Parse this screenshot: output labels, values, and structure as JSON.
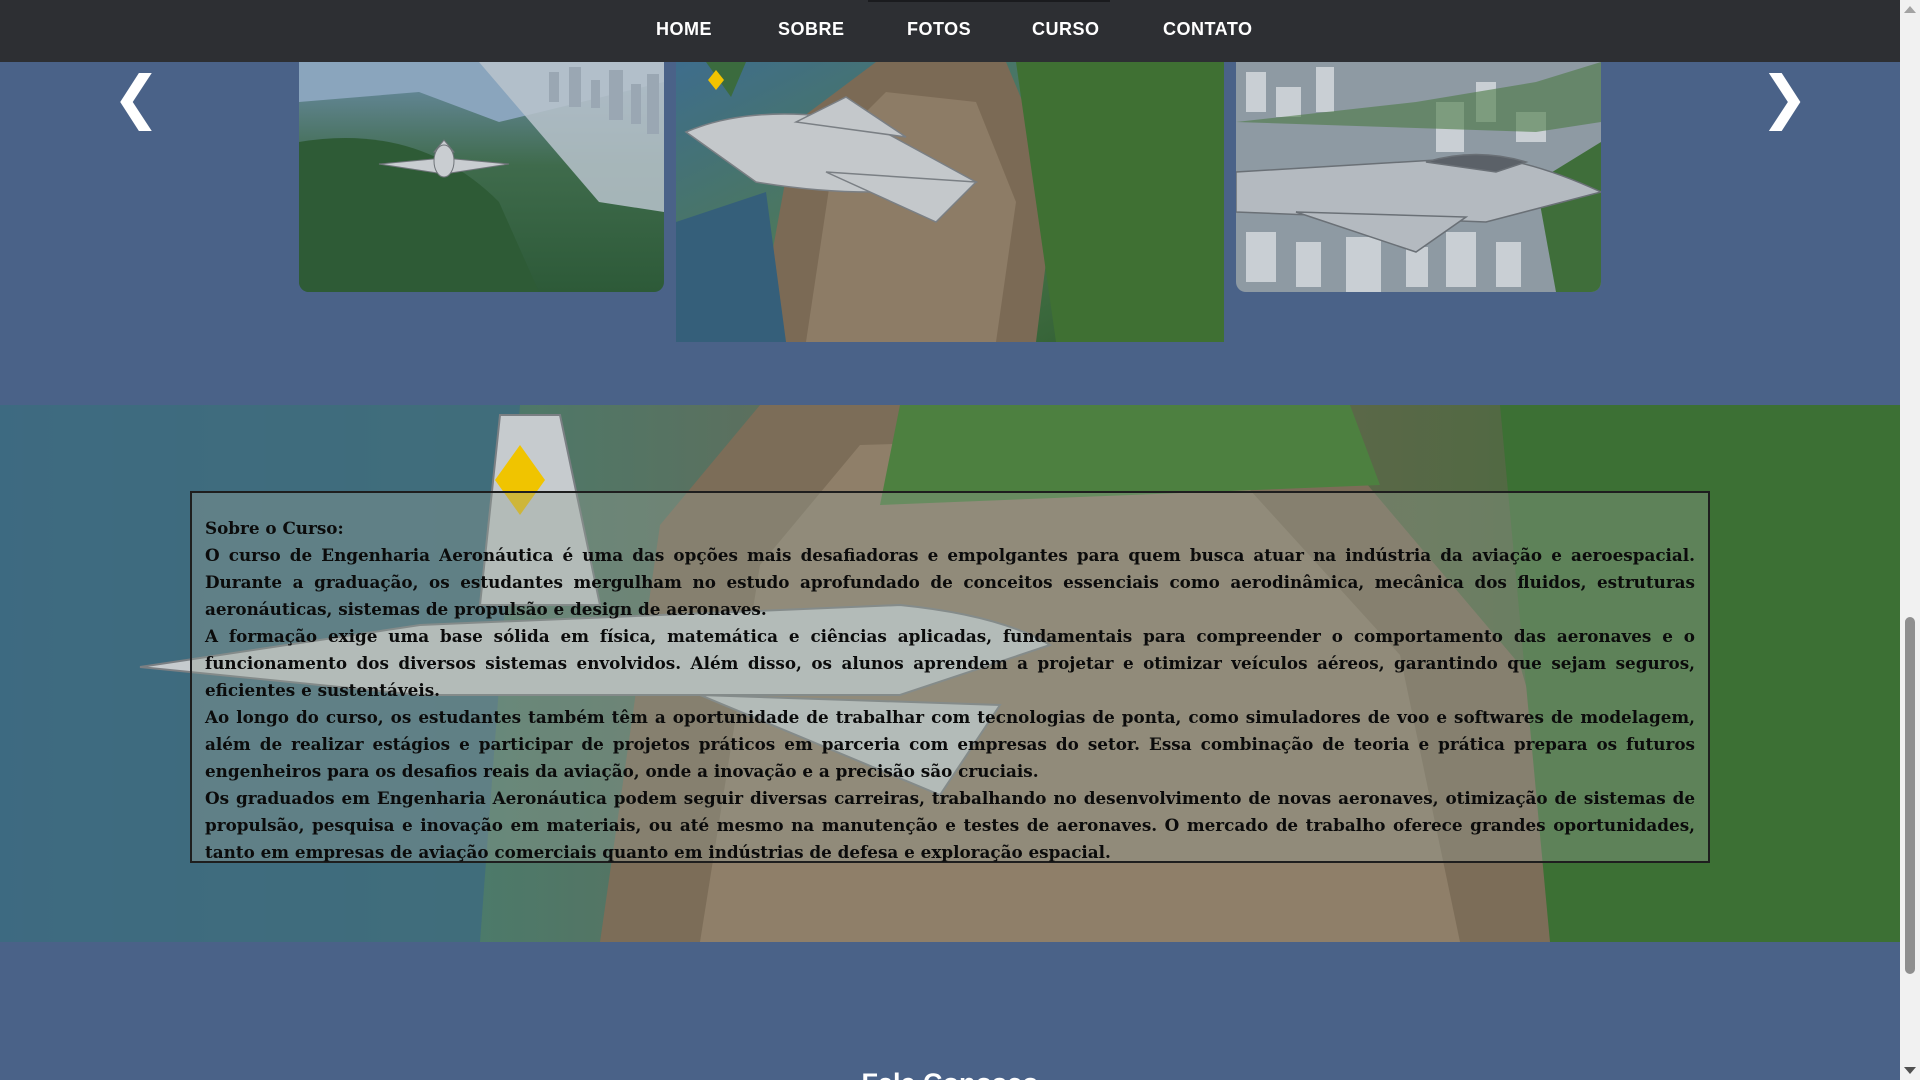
{
  "nav": {
    "items": [
      "HOME",
      "SOBRE",
      "FOTOS",
      "CURSO",
      "CONTATO"
    ]
  },
  "carousel": {
    "prev_icon": "chevron-left-icon",
    "prev_glyph": "❮",
    "next_icon": "chevron-right-icon",
    "next_glyph": "❯",
    "slides": [
      "jet-over-city-slide",
      "jet-near-mountain-slide",
      "jet-side-view-slide"
    ]
  },
  "course": {
    "heading": "Sobre o Curso:",
    "paragraphs": [
      "O curso de Engenharia Aeronáutica é uma das opções mais desafiadoras e empolgantes para quem busca atuar na indústria da aviação e aeroespacial. Durante a graduação, os estudantes mergulham no estudo aprofundado de conceitos essenciais como aerodinâmica, mecânica dos fluidos, estruturas aeronáuticas, sistemas de propulsão e design de aeronaves.",
      "A formação exige uma base sólida em física, matemática e ciências aplicadas, fundamentais para compreender o comportamento das aeronaves e o funcionamento dos diversos sistemas envolvidos. Além disso, os alunos aprendem a projetar e otimizar veículos aéreos, garantindo que sejam seguros, eficientes e sustentáveis.",
      "Ao longo do curso, os estudantes também têm a oportunidade de trabalhar com tecnologias de ponta, como simuladores de voo e softwares de modelagem, além de realizar estágios e participar de projetos práticos em parceria com empresas do setor. Essa combinação de teoria e prática prepara os futuros engenheiros para os desafios reais da aviação, onde a inovação e a precisão são cruciais.",
      "Os graduados em Engenharia Aeronáutica podem seguir diversas carreiras, trabalhando no desenvolvimento de novas aeronaves, otimização de sistemas de propulsão, pesquisa e inovação em materiais, ou até mesmo na manutenção e testes de aeronaves. O mercado de trabalho oferece grandes oportunidades, tanto em empresas de aviação comerciais quanto em indústrias de defesa e exploração espacial."
    ]
  },
  "contact": {
    "title": "Fale Conosco"
  },
  "colors": {
    "page_bg": "#4a6288",
    "nav_bg": "#2d2f33",
    "nav_text": "#ffffff"
  }
}
